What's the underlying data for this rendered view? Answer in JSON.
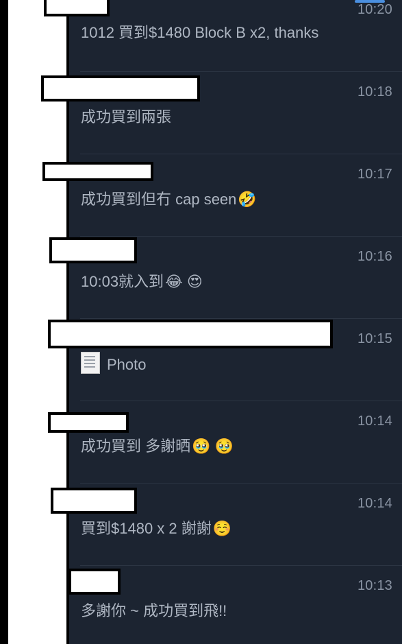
{
  "messages": [
    {
      "time": "10:20",
      "text": "1012 買到$1480 Block B x2, thanks",
      "emoji": ""
    },
    {
      "time": "10:18",
      "text": "成功買到兩張",
      "emoji": ""
    },
    {
      "time": "10:17",
      "text": "成功買到但冇 cap seen",
      "emoji": "🤣"
    },
    {
      "time": "10:16",
      "text": "10:03就入到",
      "emoji": "😂 😍"
    },
    {
      "time": "10:15",
      "text": "Photo",
      "emoji": ""
    },
    {
      "time": "10:14",
      "text": "成功買到 多謝晒",
      "emoji": "🥹 🥹"
    },
    {
      "time": "10:14",
      "text": "買到$1480 x 2 謝謝",
      "emoji": "☺️"
    },
    {
      "time": "10:13",
      "text": "多謝你 ~ 成功買到飛!!",
      "emoji": ""
    }
  ],
  "colors": {
    "background": "#1c2431",
    "text": "#aeb6c2",
    "time": "#8a94a3",
    "separator": "#2c3543"
  },
  "icons": {
    "photo": "photo-thumbnail-icon"
  }
}
